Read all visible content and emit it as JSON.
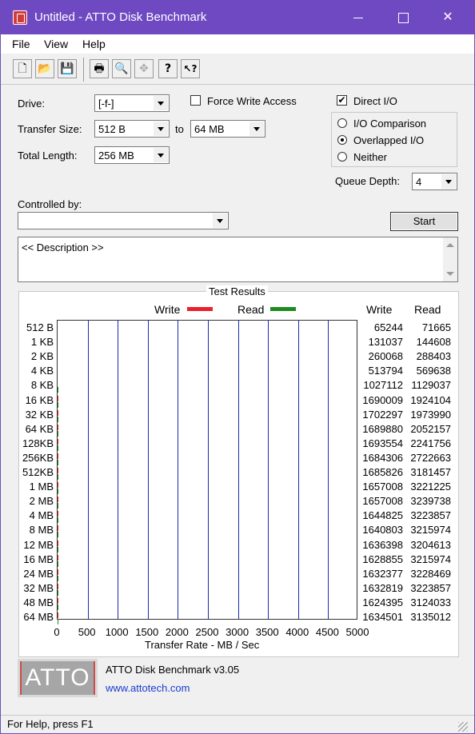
{
  "window": {
    "title": "Untitled - ATTO Disk Benchmark",
    "minimize": "",
    "maximize": "",
    "close": "✕"
  },
  "menu": [
    "File",
    "View",
    "Help"
  ],
  "toolbar": {
    "icons": [
      "new-icon",
      "open-icon",
      "save-icon",
      "print-icon",
      "print-preview-icon",
      "move-icon",
      "help-icon",
      "context-help-icon"
    ],
    "glyphs": [
      "🗋",
      "📂",
      "💾",
      "🖶",
      "🔍",
      "✥",
      "?",
      "↖?"
    ]
  },
  "form": {
    "drive_label": "Drive:",
    "drive_value": "[-f-]",
    "force_write_label": "Force Write Access",
    "force_write_checked": false,
    "direct_io_label": "Direct I/O",
    "direct_io_checked": true,
    "direct_io_check": "✔",
    "transfer_size_label": "Transfer Size:",
    "transfer_from": "512 B",
    "to_label": "to",
    "transfer_to": "64 MB",
    "total_length_label": "Total Length:",
    "total_length_value": "256 MB",
    "io_options": [
      "I/O Comparison",
      "Overlapped I/O",
      "Neither"
    ],
    "io_selected": "Overlapped I/O",
    "queue_depth_label": "Queue Depth:",
    "queue_depth_value": "4",
    "controlled_by_label": "Controlled by:",
    "controlled_by_value": "",
    "start_label": "Start",
    "description": "<< Description >>"
  },
  "results": {
    "title": "Test Results",
    "legend_write": "Write",
    "legend_read": "Read",
    "col_write": "Write",
    "col_read": "Read",
    "colors": {
      "write": "#e8212c",
      "read": "#1f8b1f",
      "grid": "#1b2bb0"
    }
  },
  "chart_data": {
    "type": "bar",
    "orientation": "horizontal",
    "categories": [
      "512 B",
      "1 KB",
      "2 KB",
      "4 KB",
      "8 KB",
      "16 KB",
      "32 KB",
      "64 KB",
      "128KB",
      "256KB",
      "512KB",
      "1 MB",
      "2 MB",
      "4 MB",
      "8 MB",
      "12 MB",
      "16 MB",
      "24 MB",
      "32 MB",
      "48 MB",
      "64 MB"
    ],
    "series": [
      {
        "name": "Write",
        "values": [
          65244,
          131037,
          260068,
          513794,
          1027112,
          1690009,
          1702297,
          1689880,
          1693554,
          1684306,
          1685826,
          1657008,
          1657008,
          1644825,
          1640803,
          1636398,
          1628855,
          1632377,
          1632819,
          1624395,
          1634501
        ]
      },
      {
        "name": "Read",
        "values": [
          71665,
          144608,
          288403,
          569638,
          1129037,
          1924104,
          1973990,
          2052157,
          2241756,
          2722663,
          3181457,
          3221225,
          3239738,
          3223857,
          3215974,
          3204613,
          3215974,
          3228469,
          3223857,
          3124033,
          3135012
        ]
      }
    ],
    "xticks": [
      "0",
      "500",
      "1000",
      "1500",
      "2000",
      "2500",
      "3000",
      "3500",
      "4000",
      "4500",
      "5000"
    ],
    "xlim": [
      0,
      5000
    ],
    "xlabel": "Transfer Rate - MB / Sec",
    "grid": true,
    "legend": "top"
  },
  "logo": {
    "text": "ATTO"
  },
  "about": {
    "product": "ATTO Disk Benchmark v3.05",
    "url": "www.attotech.com"
  },
  "status": {
    "text": "For Help, press F1"
  }
}
